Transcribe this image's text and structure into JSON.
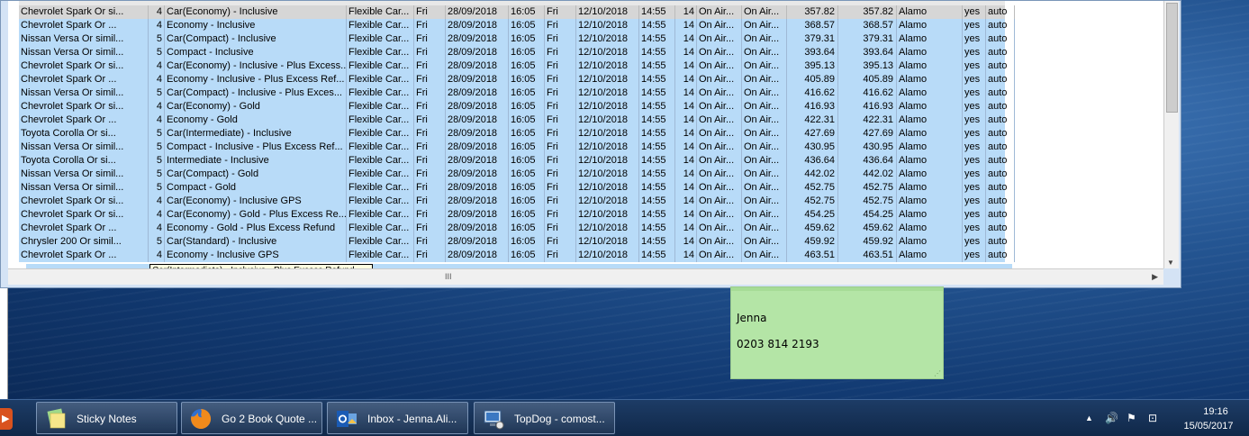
{
  "left_strip": [
    "0",
    "0",
    "0",
    "0",
    "0",
    "0"
  ],
  "grid": {
    "rows": [
      {
        "desc": "Chevrolet Spark Or si...",
        "seats": "4",
        "group": "Car(Economy) - Inclusive",
        "supplier": "Flexible Car...",
        "pday": "Fri",
        "pdate": "28/09/2018",
        "ptime": "16:05",
        "dday": "Fri",
        "ddate": "12/10/2018",
        "dtime": "14:55",
        "days": "14",
        "ploc": "On Air...",
        "dloc": "On Air...",
        "price": "357.82",
        "total": "357.82",
        "vendor": "Alamo",
        "yn": "yes",
        "trans": "auto"
      },
      {
        "desc": "Chevrolet  Spark Or ...",
        "seats": "4",
        "group": "Economy - Inclusive",
        "supplier": "Flexible Car...",
        "pday": "Fri",
        "pdate": "28/09/2018",
        "ptime": "16:05",
        "dday": "Fri",
        "ddate": "12/10/2018",
        "dtime": "14:55",
        "days": "14",
        "ploc": "On Air...",
        "dloc": "On Air...",
        "price": "368.57",
        "total": "368.57",
        "vendor": "Alamo",
        "yn": "yes",
        "trans": "auto"
      },
      {
        "desc": "Nissan Versa Or simil...",
        "seats": "5",
        "group": "Car(Compact) - Inclusive",
        "supplier": "Flexible Car...",
        "pday": "Fri",
        "pdate": "28/09/2018",
        "ptime": "16:05",
        "dday": "Fri",
        "ddate": "12/10/2018",
        "dtime": "14:55",
        "days": "14",
        "ploc": "On Air...",
        "dloc": "On Air...",
        "price": "379.31",
        "total": "379.31",
        "vendor": "Alamo",
        "yn": "yes",
        "trans": "auto"
      },
      {
        "desc": "Nissan Versa Or simil...",
        "seats": "5",
        "group": "Compact - Inclusive",
        "supplier": "Flexible Car...",
        "pday": "Fri",
        "pdate": "28/09/2018",
        "ptime": "16:05",
        "dday": "Fri",
        "ddate": "12/10/2018",
        "dtime": "14:55",
        "days": "14",
        "ploc": "On Air...",
        "dloc": "On Air...",
        "price": "393.64",
        "total": "393.64",
        "vendor": "Alamo",
        "yn": "yes",
        "trans": "auto"
      },
      {
        "desc": "Chevrolet Spark Or si...",
        "seats": "4",
        "group": "Car(Economy) - Inclusive - Plus Excess...",
        "supplier": "Flexible Car...",
        "pday": "Fri",
        "pdate": "28/09/2018",
        "ptime": "16:05",
        "dday": "Fri",
        "ddate": "12/10/2018",
        "dtime": "14:55",
        "days": "14",
        "ploc": "On Air...",
        "dloc": "On Air...",
        "price": "395.13",
        "total": "395.13",
        "vendor": "Alamo",
        "yn": "yes",
        "trans": "auto"
      },
      {
        "desc": "Chevrolet  Spark Or ...",
        "seats": "4",
        "group": "Economy - Inclusive - Plus Excess Ref...",
        "supplier": "Flexible Car...",
        "pday": "Fri",
        "pdate": "28/09/2018",
        "ptime": "16:05",
        "dday": "Fri",
        "ddate": "12/10/2018",
        "dtime": "14:55",
        "days": "14",
        "ploc": "On Air...",
        "dloc": "On Air...",
        "price": "405.89",
        "total": "405.89",
        "vendor": "Alamo",
        "yn": "yes",
        "trans": "auto"
      },
      {
        "desc": "Nissan Versa Or simil...",
        "seats": "5",
        "group": "Car(Compact) - Inclusive - Plus Exces...",
        "supplier": "Flexible Car...",
        "pday": "Fri",
        "pdate": "28/09/2018",
        "ptime": "16:05",
        "dday": "Fri",
        "ddate": "12/10/2018",
        "dtime": "14:55",
        "days": "14",
        "ploc": "On Air...",
        "dloc": "On Air...",
        "price": "416.62",
        "total": "416.62",
        "vendor": "Alamo",
        "yn": "yes",
        "trans": "auto"
      },
      {
        "desc": "Chevrolet Spark Or si...",
        "seats": "4",
        "group": "Car(Economy) - Gold",
        "supplier": "Flexible Car...",
        "pday": "Fri",
        "pdate": "28/09/2018",
        "ptime": "16:05",
        "dday": "Fri",
        "ddate": "12/10/2018",
        "dtime": "14:55",
        "days": "14",
        "ploc": "On Air...",
        "dloc": "On Air...",
        "price": "416.93",
        "total": "416.93",
        "vendor": "Alamo",
        "yn": "yes",
        "trans": "auto"
      },
      {
        "desc": "Chevrolet  Spark Or ...",
        "seats": "4",
        "group": "Economy - Gold",
        "supplier": "Flexible Car...",
        "pday": "Fri",
        "pdate": "28/09/2018",
        "ptime": "16:05",
        "dday": "Fri",
        "ddate": "12/10/2018",
        "dtime": "14:55",
        "days": "14",
        "ploc": "On Air...",
        "dloc": "On Air...",
        "price": "422.31",
        "total": "422.31",
        "vendor": "Alamo",
        "yn": "yes",
        "trans": "auto"
      },
      {
        "desc": "Toyota Corolla Or si...",
        "seats": "5",
        "group": "Car(Intermediate) - Inclusive",
        "supplier": "Flexible Car...",
        "pday": "Fri",
        "pdate": "28/09/2018",
        "ptime": "16:05",
        "dday": "Fri",
        "ddate": "12/10/2018",
        "dtime": "14:55",
        "days": "14",
        "ploc": "On Air...",
        "dloc": "On Air...",
        "price": "427.69",
        "total": "427.69",
        "vendor": "Alamo",
        "yn": "yes",
        "trans": "auto"
      },
      {
        "desc": "Nissan Versa Or simil...",
        "seats": "5",
        "group": "Compact - Inclusive - Plus Excess Ref...",
        "supplier": "Flexible Car...",
        "pday": "Fri",
        "pdate": "28/09/2018",
        "ptime": "16:05",
        "dday": "Fri",
        "ddate": "12/10/2018",
        "dtime": "14:55",
        "days": "14",
        "ploc": "On Air...",
        "dloc": "On Air...",
        "price": "430.95",
        "total": "430.95",
        "vendor": "Alamo",
        "yn": "yes",
        "trans": "auto"
      },
      {
        "desc": "Toyota Corolla Or si...",
        "seats": "5",
        "group": "Intermediate - Inclusive",
        "supplier": "Flexible Car...",
        "pday": "Fri",
        "pdate": "28/09/2018",
        "ptime": "16:05",
        "dday": "Fri",
        "ddate": "12/10/2018",
        "dtime": "14:55",
        "days": "14",
        "ploc": "On Air...",
        "dloc": "On Air...",
        "price": "436.64",
        "total": "436.64",
        "vendor": "Alamo",
        "yn": "yes",
        "trans": "auto"
      },
      {
        "desc": "Nissan Versa Or simil...",
        "seats": "5",
        "group": "Car(Compact) - Gold",
        "supplier": "Flexible Car...",
        "pday": "Fri",
        "pdate": "28/09/2018",
        "ptime": "16:05",
        "dday": "Fri",
        "ddate": "12/10/2018",
        "dtime": "14:55",
        "days": "14",
        "ploc": "On Air...",
        "dloc": "On Air...",
        "price": "442.02",
        "total": "442.02",
        "vendor": "Alamo",
        "yn": "yes",
        "trans": "auto"
      },
      {
        "desc": "Nissan Versa Or simil...",
        "seats": "5",
        "group": "Compact - Gold",
        "supplier": "Flexible Car...",
        "pday": "Fri",
        "pdate": "28/09/2018",
        "ptime": "16:05",
        "dday": "Fri",
        "ddate": "12/10/2018",
        "dtime": "14:55",
        "days": "14",
        "ploc": "On Air...",
        "dloc": "On Air...",
        "price": "452.75",
        "total": "452.75",
        "vendor": "Alamo",
        "yn": "yes",
        "trans": "auto"
      },
      {
        "desc": "Chevrolet Spark Or si...",
        "seats": "4",
        "group": "Car(Economy) - Inclusive GPS",
        "supplier": "Flexible Car...",
        "pday": "Fri",
        "pdate": "28/09/2018",
        "ptime": "16:05",
        "dday": "Fri",
        "ddate": "12/10/2018",
        "dtime": "14:55",
        "days": "14",
        "ploc": "On Air...",
        "dloc": "On Air...",
        "price": "452.75",
        "total": "452.75",
        "vendor": "Alamo",
        "yn": "yes",
        "trans": "auto"
      },
      {
        "desc": "Chevrolet Spark Or si...",
        "seats": "4",
        "group": "Car(Economy) - Gold - Plus Excess Re...",
        "supplier": "Flexible Car...",
        "pday": "Fri",
        "pdate": "28/09/2018",
        "ptime": "16:05",
        "dday": "Fri",
        "ddate": "12/10/2018",
        "dtime": "14:55",
        "days": "14",
        "ploc": "On Air...",
        "dloc": "On Air...",
        "price": "454.25",
        "total": "454.25",
        "vendor": "Alamo",
        "yn": "yes",
        "trans": "auto"
      },
      {
        "desc": "Chevrolet  Spark Or ...",
        "seats": "4",
        "group": "Economy - Gold - Plus Excess Refund",
        "supplier": "Flexible Car...",
        "pday": "Fri",
        "pdate": "28/09/2018",
        "ptime": "16:05",
        "dday": "Fri",
        "ddate": "12/10/2018",
        "dtime": "14:55",
        "days": "14",
        "ploc": "On Air...",
        "dloc": "On Air...",
        "price": "459.62",
        "total": "459.62",
        "vendor": "Alamo",
        "yn": "yes",
        "trans": "auto"
      },
      {
        "desc": "Chrysler 200 Or simil...",
        "seats": "5",
        "group": "Car(Standard) - Inclusive",
        "supplier": "Flexible Car...",
        "pday": "Fri",
        "pdate": "28/09/2018",
        "ptime": "16:05",
        "dday": "Fri",
        "ddate": "12/10/2018",
        "dtime": "14:55",
        "days": "14",
        "ploc": "On Air...",
        "dloc": "On Air...",
        "price": "459.92",
        "total": "459.92",
        "vendor": "Alamo",
        "yn": "yes",
        "trans": "auto"
      },
      {
        "desc": "Chevrolet  Spark Or ...",
        "seats": "4",
        "group": "Economy - Inclusive GPS",
        "supplier": "Flexible Car...",
        "pday": "Fri",
        "pdate": "28/09/2018",
        "ptime": "16:05",
        "dday": "Fri",
        "ddate": "12/10/2018",
        "dtime": "14:55",
        "days": "14",
        "ploc": "On Air...",
        "dloc": "On Air...",
        "price": "463.51",
        "total": "463.51",
        "vendor": "Alamo",
        "yn": "yes",
        "trans": "auto"
      }
    ],
    "tooltip": "Car(Intermediate) - Inclusive - Plus Excess Refund",
    "hscroll_grip": "III",
    "vscroll_arrow": "▼",
    "hscroll_arrow": "▶"
  },
  "sticky_note": {
    "line1": "Jenna",
    "line2": "0203 814 2193",
    "resize": "⋰"
  },
  "taskbar": {
    "start_glyph": "▶",
    "buttons": [
      {
        "label": "Sticky Notes",
        "icon": "sticky-notes-icon"
      },
      {
        "label": "Go 2 Book Quote ...",
        "icon": "firefox-icon"
      },
      {
        "label": "Inbox - Jenna.Ali...",
        "icon": "outlook-icon"
      },
      {
        "label": "TopDog - comost...",
        "icon": "remote-desktop-icon"
      }
    ],
    "tray": {
      "up_arrow": "▲",
      "volume": "🔊",
      "flag": "⚑",
      "network": "⊡",
      "time": "19:16",
      "date": "15/05/2017"
    }
  }
}
